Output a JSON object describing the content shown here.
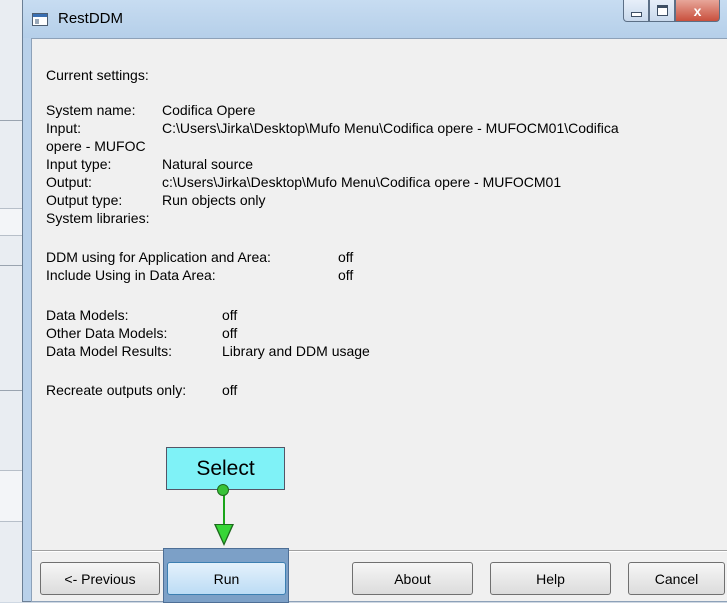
{
  "window": {
    "title": "RestDDM",
    "close_glyph": "x"
  },
  "settings": {
    "header": "Current settings:",
    "rows": [
      {
        "label": "System name:",
        "value": "Codifica Opere"
      },
      {
        "label": "Input:",
        "value": "C:\\Users\\Jirka\\Desktop\\Mufo Menu\\Codifica opere - MUFOCM01\\Codifica"
      },
      {
        "label": "",
        "value": "opere - MUFOC"
      },
      {
        "label": "Input type:",
        "value": "Natural source"
      },
      {
        "label": "Output:",
        "value": "c:\\Users\\Jirka\\Desktop\\Mufo Menu\\Codifica opere - MUFOCM01"
      },
      {
        "label": "Output type:",
        "value": "Run objects only"
      },
      {
        "label": "System libraries:",
        "value": ""
      }
    ],
    "ddm_using": {
      "label": "DDM using for Application and Area:",
      "value": "off"
    },
    "include_using": {
      "label": "Include Using in Data Area:",
      "value": "off"
    },
    "data_models": {
      "label": "Data Models:",
      "value": "off"
    },
    "other_data_models": {
      "label": "Other Data Models:",
      "value": "off"
    },
    "data_model_results": {
      "label": "Data Model Results:",
      "value": "Library and DDM usage"
    },
    "recreate_outputs": {
      "label": "Recreate outputs only:",
      "value": "off"
    }
  },
  "buttons": {
    "previous": "<- Previous",
    "run": "Run",
    "about": "About",
    "help": "Help",
    "cancel": "Cancel"
  },
  "annotation": {
    "label": "Select",
    "box_color": "#7ff2f7",
    "arrow_color": "#37d637"
  }
}
